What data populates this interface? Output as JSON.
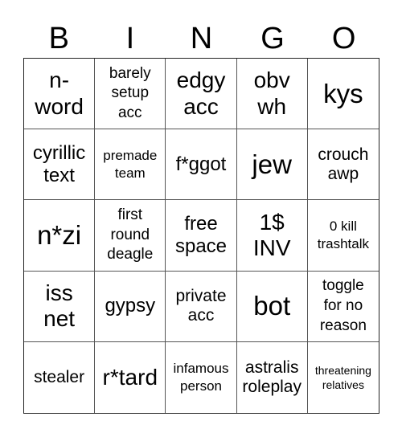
{
  "header": {
    "letters": [
      "B",
      "I",
      "N",
      "G",
      "O"
    ]
  },
  "cells": [
    {
      "text": "n-\nword"
    },
    {
      "text": "barely\nsetup\nacc"
    },
    {
      "text": "edgy\nacc"
    },
    {
      "text": "obv\nwh"
    },
    {
      "text": "kys"
    },
    {
      "text": "cyrillic\ntext"
    },
    {
      "text": "premade\nteam"
    },
    {
      "text": "f*ggot"
    },
    {
      "text": "jew"
    },
    {
      "text": "crouch\nawp"
    },
    {
      "text": "n*zi"
    },
    {
      "text": "first\nround\ndeagle"
    },
    {
      "text": "free\nspace"
    },
    {
      "text": "1$\nINV"
    },
    {
      "text": "0 kill\ntrashtalk"
    },
    {
      "text": "iss\nnet"
    },
    {
      "text": "gypsy"
    },
    {
      "text": "private\nacc"
    },
    {
      "text": "bot"
    },
    {
      "text": "toggle\nfor no\nreason"
    },
    {
      "text": "stealer"
    },
    {
      "text": "r*tard"
    },
    {
      "text": "infamous\nperson"
    },
    {
      "text": "astralis\nroleplay"
    },
    {
      "text": "threatening\nrelatives"
    }
  ]
}
